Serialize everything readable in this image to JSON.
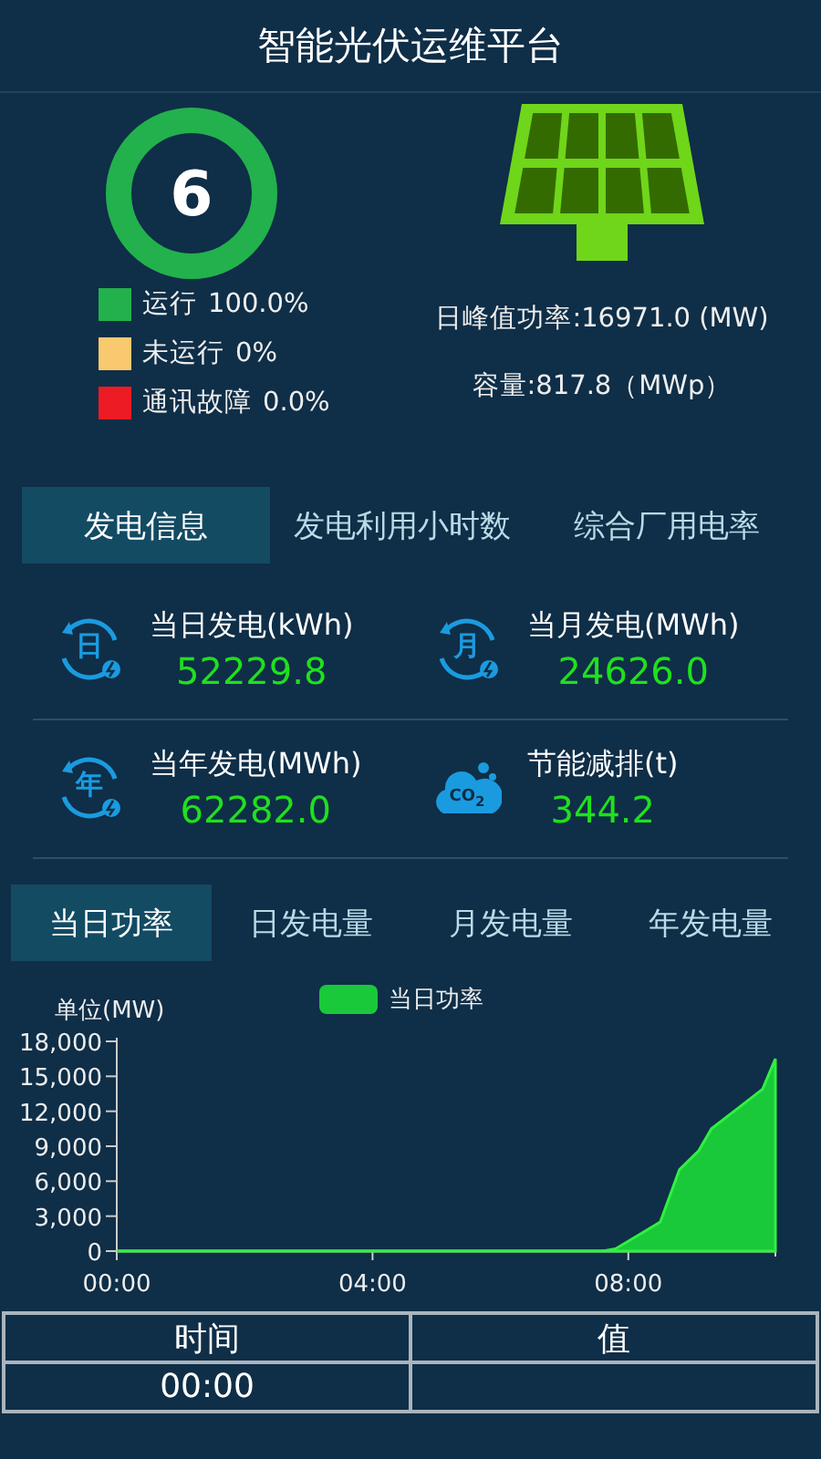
{
  "header": {
    "title": "智能光伏运维平台"
  },
  "summary": {
    "count": "6",
    "legend": [
      {
        "label": "运行",
        "value": "100.0%",
        "color": "#22b14c"
      },
      {
        "label": "未运行",
        "value": "0%",
        "color": "#f8c96f"
      },
      {
        "label": "通讯故障",
        "value": "0.0%",
        "color": "#ed1c24"
      }
    ],
    "peak_power": "日峰值功率:16971.0 (MW)",
    "capacity": "容量:817.8（MWp）"
  },
  "info_tabs": [
    {
      "label": "发电信息",
      "selected": true
    },
    {
      "label": "发电利用小时数",
      "selected": false
    },
    {
      "label": "综合厂用电率",
      "selected": false
    }
  ],
  "stats": [
    {
      "kind": "cycle",
      "icon_text": "日",
      "label": "当日发电(kWh)",
      "value": "52229.8"
    },
    {
      "kind": "cycle",
      "icon_text": "月",
      "label": "当月发电(MWh)",
      "value": "24626.0"
    },
    {
      "kind": "cycle",
      "icon_text": "年",
      "label": "当年发电(MWh)",
      "value": "62282.0"
    },
    {
      "kind": "cloud",
      "icon_text": "CO$_{2}$",
      "label": "节能减排(t)",
      "value": "344.2"
    }
  ],
  "chart_tabs": [
    {
      "label": "当日功率",
      "selected": true
    },
    {
      "label": "日发电量",
      "selected": false
    },
    {
      "label": "月发电量",
      "selected": false
    },
    {
      "label": "年发电量",
      "selected": false
    }
  ],
  "chart": {
    "chart_data": {
      "type": "area",
      "ylabel": "单位(MW)",
      "x": [
        0,
        1,
        2,
        3,
        4,
        5,
        6,
        7,
        7.6,
        7.8,
        8.2,
        8.5,
        8.7,
        8.8,
        9.1,
        9.3,
        9.7,
        10.1,
        10.3
      ],
      "series": [
        {
          "name": "当日功率",
          "color": "#19c93a",
          "values": [
            0,
            0,
            0,
            0,
            0,
            0,
            0,
            0,
            0,
            200,
            1500,
            2500,
            5500,
            7000,
            8600,
            10500,
            12200,
            13900,
            16500
          ]
        }
      ],
      "xlim": [
        0,
        10.3
      ],
      "ylim": [
        0,
        18000
      ],
      "xticks": [
        {
          "value": 0,
          "label": "00:00"
        },
        {
          "value": 4,
          "label": "04:00"
        },
        {
          "value": 8,
          "label": "08:00"
        }
      ],
      "yticks": [
        {
          "value": 0,
          "label": "0"
        },
        {
          "value": 3000,
          "label": "3,000"
        },
        {
          "value": 6000,
          "label": "6,000"
        },
        {
          "value": 9000,
          "label": "9,000"
        },
        {
          "value": 12000,
          "label": "12,000"
        },
        {
          "value": 15000,
          "label": "15,000"
        },
        {
          "value": 18000,
          "label": "18,000"
        }
      ]
    }
  },
  "table": {
    "columns": [
      "时间",
      "值"
    ],
    "rows": [
      [
        "00:00",
        ""
      ]
    ]
  }
}
